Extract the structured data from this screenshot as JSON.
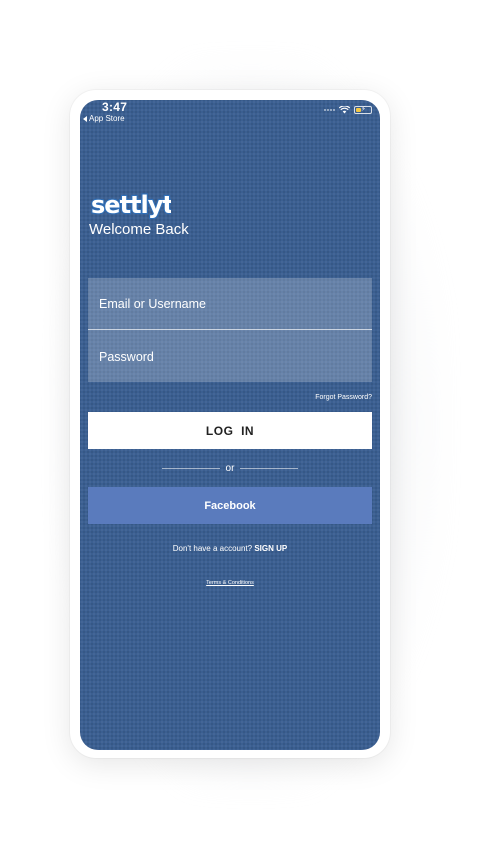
{
  "status_bar": {
    "time": "3:47",
    "back_label": "App Store"
  },
  "brand": {
    "logo_text": "settlyt.",
    "welcome": "Welcome Back"
  },
  "form": {
    "email_placeholder": "Email or Username",
    "email_value": "",
    "password_placeholder": "Password",
    "password_value": "",
    "forgot_label": "Forgot Password?",
    "login_label": "LOG  IN",
    "or_label": "or",
    "facebook_label": "Facebook"
  },
  "footer": {
    "signup_prompt": "Don't have a account?",
    "signup_label": "SIGN UP",
    "terms_label": "Terms & Conditions"
  },
  "colors": {
    "background": "#3b5f91",
    "facebook_button": "#5a7bbd",
    "login_button": "#ffffff",
    "logo_fill": "#ffffff",
    "logo_outline": "#2f6fb8",
    "battery": "#f2c744"
  },
  "icons": [
    "back-caret-icon",
    "signal-icon",
    "wifi-icon",
    "battery-icon"
  ]
}
